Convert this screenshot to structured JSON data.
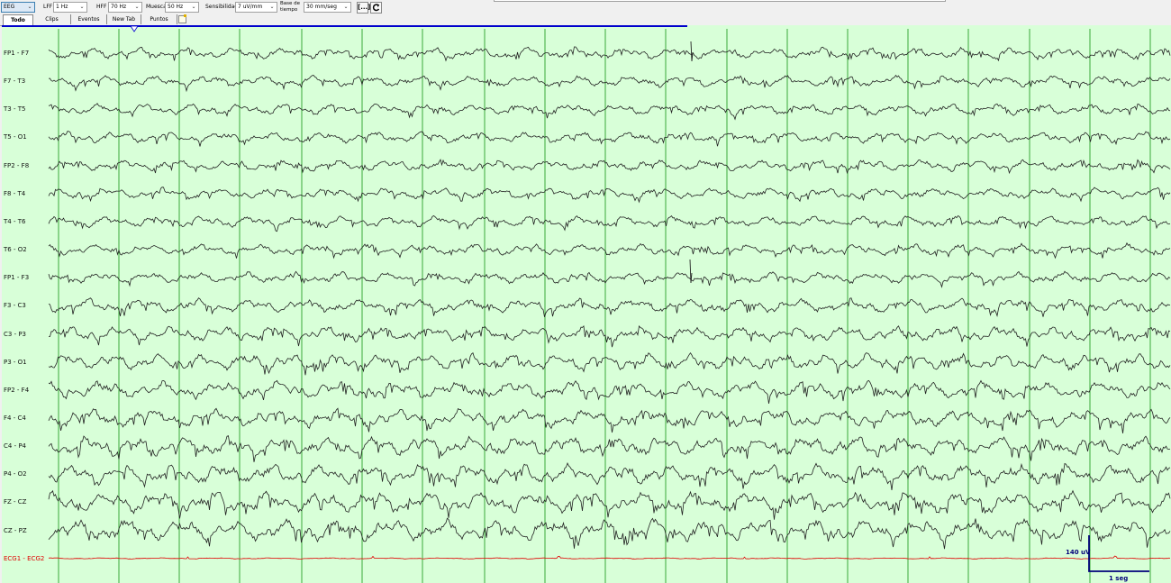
{
  "toolbar": {
    "montage": "EEG",
    "lff_label": "LFF",
    "lff_value": "1 Hz",
    "hff_label": "HFF",
    "hff_value": "70 Hz",
    "notch_label": "Muesca",
    "notch_value": "50 Hz",
    "sensitivity_label": "Sensibilidad",
    "sensitivity_value": "7 uV/mm",
    "timebase_label_1": "Base de",
    "timebase_label_2": "tiempo",
    "timebase_value": "30 mm/seg",
    "fit_button": "[...]",
    "refresh_icon": "refresh-icon"
  },
  "tabs": [
    "Todo",
    "Clips",
    "Eventos",
    "New Tab",
    "Puntos"
  ],
  "active_tab": "Todo",
  "channels": [
    "FP1 - F7",
    "F7 - T3",
    "T3 - T5",
    "T5 - O1",
    "FP2 - F8",
    "F8 - T4",
    "T4 - T6",
    "T6 - O2",
    "FP1 - F3",
    "F3 - C3",
    "C3 - P3",
    "P3 - O1",
    "FP2 - F4",
    "F4 - C4",
    "C4 - P4",
    "P4 - O2",
    "FZ - CZ",
    "CZ - PZ",
    "ECG1 - ECG2"
  ],
  "calibration": {
    "amplitude": "140 uV",
    "time": "1 seg"
  },
  "colors": {
    "background": "#d8ffd8",
    "grid": "#3aaa3a",
    "trace": "#222222",
    "ecg_trace": "#e00000",
    "progress": "#0000cc",
    "calibration": "#00007a"
  }
}
